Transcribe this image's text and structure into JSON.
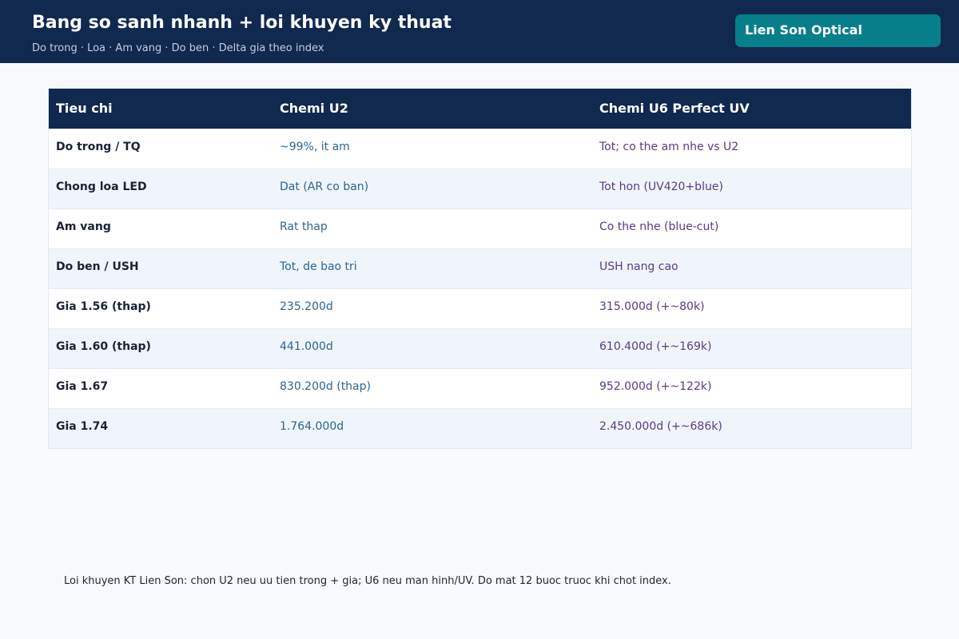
{
  "header": {
    "title": "Bang so sanh nhanh + loi khuyen ky thuat",
    "subtitle": "Do trong · Loa · Am vang · Do ben · Delta gia theo index",
    "brand": "Lien Son Optical"
  },
  "table": {
    "columns": [
      "Tieu chi",
      "Chemi U2",
      "Chemi U6 Perfect UV"
    ],
    "rows": [
      [
        "Do trong / TQ",
        "~99%, it am",
        "Tot; co the am nhe vs U2"
      ],
      [
        "Chong loa LED",
        "Dat (AR co ban)",
        "Tot hon (UV420+blue)"
      ],
      [
        "Am vang",
        "Rat thap",
        "Co the nhe (blue-cut)"
      ],
      [
        "Do ben / USH",
        "Tot, de bao tri",
        "USH nang cao"
      ],
      [
        "Gia 1.56 (thap)",
        "235.200d",
        "315.000d (+~80k)"
      ],
      [
        "Gia 1.60 (thap)",
        "441.000d",
        "610.400d (+~169k)"
      ],
      [
        "Gia 1.67",
        "830.200d (thap)",
        "952.000d (+~122k)"
      ],
      [
        "Gia 1.74",
        "1.764.000d",
        "2.450.000d (+~686k)"
      ]
    ]
  },
  "footer": {
    "tip": "Loi khuyen KT Lien Son: chon U2 neu uu tien trong + gia; U6 neu man hinh/UV. Do mat 12 buoc truoc khi chot index."
  },
  "colors": {
    "header_bg": "#11284f",
    "brand_bg": "#067f8a",
    "u2_text": "#2c6492",
    "u6_text": "#5a3a86",
    "row_alt": "#f0f5fb"
  }
}
